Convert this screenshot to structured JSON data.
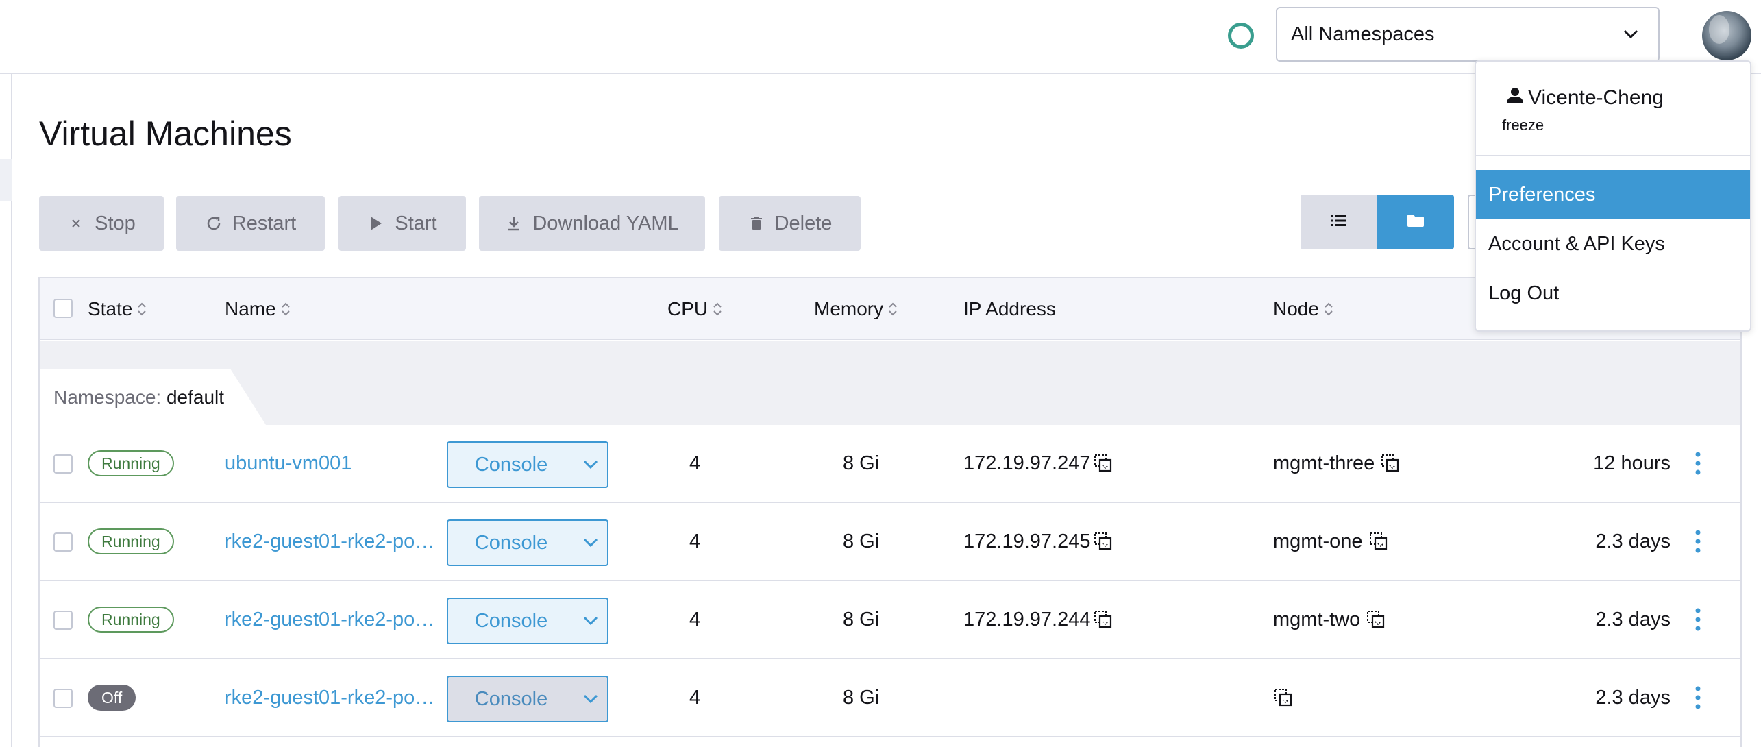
{
  "header": {
    "namespace_select": "All Namespaces"
  },
  "page": {
    "title": "Virtual Machines"
  },
  "toolbar": {
    "stop": "Stop",
    "restart": "Restart",
    "start": "Start",
    "download_yaml": "Download YAML",
    "delete": "Delete"
  },
  "table": {
    "columns": {
      "state": "State",
      "name": "Name",
      "cpu": "CPU",
      "memory": "Memory",
      "ip": "IP Address",
      "node": "Node"
    },
    "group": {
      "label": "Namespace:",
      "value": "default"
    },
    "rows": [
      {
        "state": "Running",
        "name": "ubuntu-vm001",
        "console": "Console",
        "cpu": "4",
        "memory": "8 Gi",
        "ip": "172.19.97.247",
        "node": "mgmt-three",
        "age": "12 hours"
      },
      {
        "state": "Running",
        "name": "rke2-guest01-rke2-pool…",
        "console": "Console",
        "cpu": "4",
        "memory": "8 Gi",
        "ip": "172.19.97.245",
        "node": "mgmt-one",
        "age": "2.3 days"
      },
      {
        "state": "Running",
        "name": "rke2-guest01-rke2-pool…",
        "console": "Console",
        "cpu": "4",
        "memory": "8 Gi",
        "ip": "172.19.97.244",
        "node": "mgmt-two",
        "age": "2.3 days"
      },
      {
        "state": "Off",
        "name": "rke2-guest01-rke2-pool…",
        "console": "Console",
        "cpu": "4",
        "memory": "8 Gi",
        "ip": "",
        "node": "",
        "age": "2.3 days"
      }
    ]
  },
  "user_menu": {
    "username": "Vicente-Cheng",
    "status": "freeze",
    "items": [
      "Preferences",
      "Account & API Keys",
      "Log Out"
    ]
  },
  "colors": {
    "accent": "#3d98d3",
    "running": "#5d995d",
    "off": "#6c6c76",
    "status_ring": "#3a9e8f"
  }
}
